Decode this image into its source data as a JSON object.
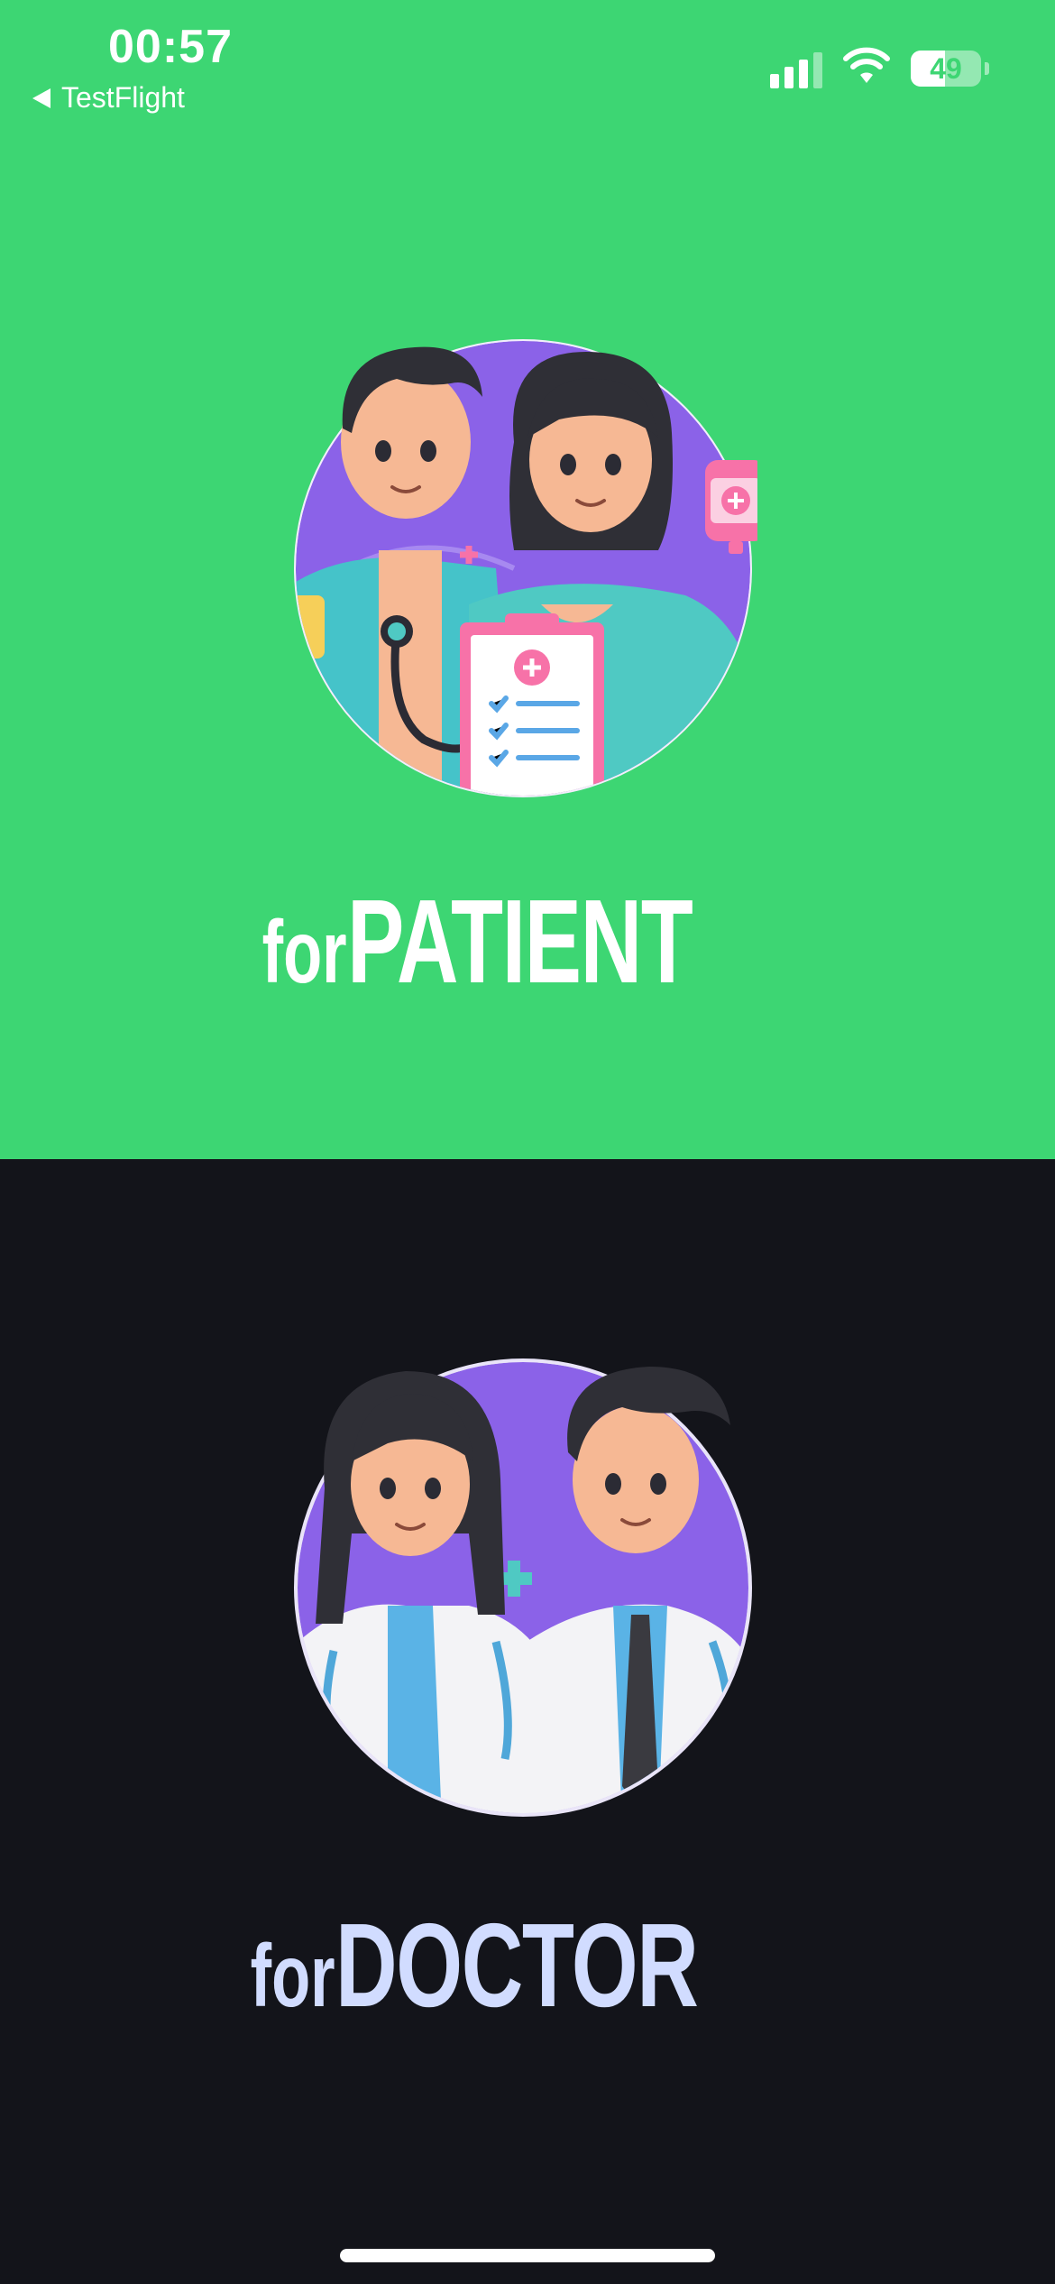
{
  "colors": {
    "patient_bg": "#3dd673",
    "doctor_bg": "#13141a",
    "patient_text": "#ffffff",
    "doctor_text": "#d1dcff",
    "status_text": "#ffffff",
    "home_indicator": "#ffffff",
    "avatar_bg": "#8b62e8"
  },
  "status_bar": {
    "time": "00:57",
    "back_label": "TestFlight",
    "back_icon": "back-arrow-icon",
    "signal_icon": "cellular-signal-icon",
    "wifi_icon": "wifi-icon",
    "battery_level": "49",
    "battery_fraction": 0.49
  },
  "patient": {
    "prefix": "for",
    "title": "PATIENT",
    "illustration": "patient-couple-illustration"
  },
  "doctor": {
    "prefix": "for",
    "title": "DOCTOR",
    "illustration": "doctor-couple-illustration"
  }
}
